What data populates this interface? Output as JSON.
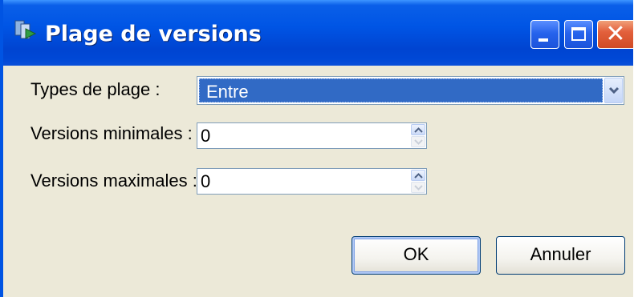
{
  "window": {
    "title": "Plage de versions",
    "icon": "versions-app-icon",
    "controls": [
      "minimize-icon",
      "maximize-icon",
      "close-icon"
    ]
  },
  "form": {
    "range_type": {
      "label": "Types de plage :",
      "selected": "Entre"
    },
    "min_versions": {
      "label": "Versions minimales :",
      "value": "0"
    },
    "max_versions": {
      "label": "Versions maximales :",
      "value": "0"
    }
  },
  "buttons": {
    "ok": "OK",
    "cancel": "Annuler"
  },
  "colors": {
    "titlebar": "#0055e5",
    "selection": "#316ac5",
    "dialog_bg": "#ece9d8",
    "close_button": "#e3603c"
  }
}
